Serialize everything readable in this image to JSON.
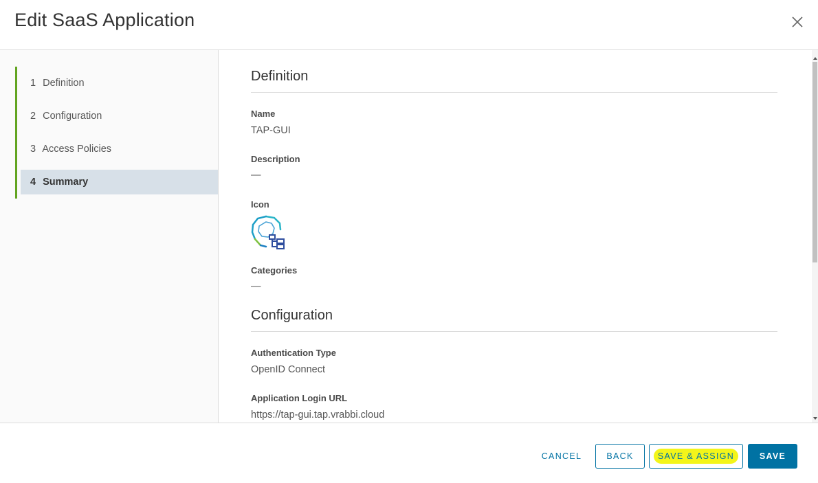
{
  "header": {
    "title": "Edit SaaS Application"
  },
  "sidebar": {
    "steps": [
      {
        "num": "1",
        "label": "Definition"
      },
      {
        "num": "2",
        "label": "Configuration"
      },
      {
        "num": "3",
        "label": "Access Policies"
      },
      {
        "num": "4",
        "label": "Summary"
      }
    ],
    "active_step": "4"
  },
  "summary": {
    "definition": {
      "title": "Definition",
      "name_label": "Name",
      "name_value": "TAP-GUI",
      "description_label": "Description",
      "description_value": "—",
      "icon_label": "Icon",
      "icon": "tanzu-app-icon",
      "categories_label": "Categories",
      "categories_value": "—"
    },
    "configuration": {
      "title": "Configuration",
      "auth_type_label": "Authentication Type",
      "auth_type_value": "OpenID Connect",
      "login_url_label": "Application Login URL",
      "login_url_value": "https://tap-gui.tap.vrabbi.cloud"
    }
  },
  "footer": {
    "cancel_label": "CANCEL",
    "back_label": "BACK",
    "save_assign_label": "SAVE & ASSIGN",
    "save_label": "SAVE"
  },
  "colors": {
    "primary": "#0072a3",
    "step_rail": "#62a420",
    "active_step_bg": "#d7e0e8",
    "highlight": "#f3f51a"
  }
}
